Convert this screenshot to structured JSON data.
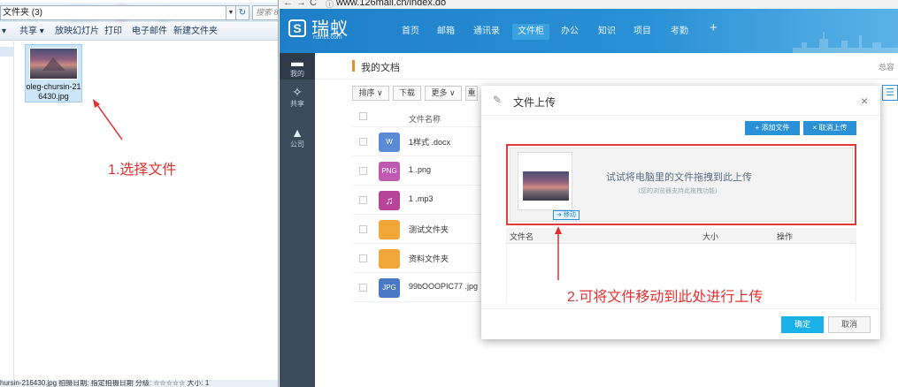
{
  "explorer": {
    "path": "文件夹 (3)",
    "search_placeholder": "搜索 8",
    "refresh": "↻",
    "toolbar": {
      "organize": "▾",
      "share": "共享 ▾",
      "slideshow": "放映幻灯片",
      "print": "打印",
      "email": "电子邮件",
      "new_folder": "新建文件夹"
    },
    "file": {
      "name": "oleg-chursin-216430.jpg",
      "name_line1": "oleg-chursin-21",
      "name_line2": "6430.jpg"
    },
    "status": "hursin-216430.jpg  拍摄日期: 指定拍摄日期      分级: ☆☆☆☆☆      大小: 1"
  },
  "annotations": {
    "step1": "1.选择文件",
    "step2": "2.可将文件移动到此处进行上传",
    "color": "#e03030"
  },
  "browser": {
    "back": "←",
    "forward": "→",
    "reload": "C",
    "info": "ⓘ",
    "url": "www.126mail.cn/index.do"
  },
  "app": {
    "logo_text": "瑞蚁",
    "logo_sub": "ruinet.com",
    "nav": [
      "首页",
      "邮箱",
      "通讯录",
      "文件柜",
      "办公",
      "知识",
      "项目",
      "考勤",
      "+"
    ],
    "active_nav": "文件柜",
    "accent": "#2a91d6",
    "rail": [
      {
        "icon": "folder-icon",
        "label": "我的"
      },
      {
        "icon": "share-icon",
        "label": "共享"
      },
      {
        "icon": "company-icon",
        "label": "公司"
      }
    ],
    "page_title": "我的文档",
    "page_title_right": "总容",
    "toolbar": {
      "sort": "排序 ∨",
      "download": "下载",
      "more": "更多 ∨",
      "extra": "重"
    },
    "table": {
      "header": "文件名称",
      "rows": [
        {
          "type": "W",
          "name": "1样式 .docx",
          "color": "#5b8ad6"
        },
        {
          "type": "PNG",
          "name": "1 .png",
          "color": "#c05ab0"
        },
        {
          "type": "♫",
          "name": "1 .mp3",
          "color": "#b8449a"
        },
        {
          "type": "",
          "name": "测试文件夹",
          "color": "#f0a73a"
        },
        {
          "type": "",
          "name": "资料文件夹",
          "color": "#f0a73a"
        },
        {
          "type": "JPG",
          "name": "99bOOOPIC77 .jpg",
          "color": "#4a78c4"
        }
      ]
    }
  },
  "modal": {
    "title": "文件上传",
    "close": "×",
    "add_file": "+ 添加文件",
    "cancel_upload": "× 取消上传",
    "drop_main": "试试将电脑里的文件拖拽到此上传",
    "drop_sub": "（您的浏览器支持此拖拽功能）",
    "drag_tag": "➜ 移动",
    "list_headers": {
      "name": "文件名",
      "size": "大小",
      "action": "操作"
    },
    "ok": "确定",
    "cancel": "取消"
  }
}
